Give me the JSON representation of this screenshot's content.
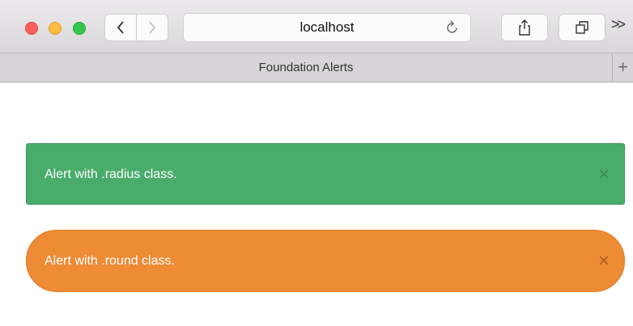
{
  "browser": {
    "url": "localhost",
    "tab_title": "Foundation Alerts",
    "new_tab_symbol": "+",
    "overflow_symbol": ">>"
  },
  "alerts": [
    {
      "text": "Alert with .radius class.",
      "close_symbol": "×",
      "color": "#4aac6b",
      "style": "radius"
    },
    {
      "text": "Alert with .round class.",
      "close_symbol": "×",
      "color": "#ee8b35",
      "style": "round"
    }
  ],
  "icons": [
    "close-window-icon",
    "minimize-window-icon",
    "zoom-window-icon",
    "chevron-left-icon",
    "chevron-right-icon",
    "reload-icon",
    "share-icon",
    "tabs-icon",
    "plus-icon",
    "close-icon"
  ]
}
